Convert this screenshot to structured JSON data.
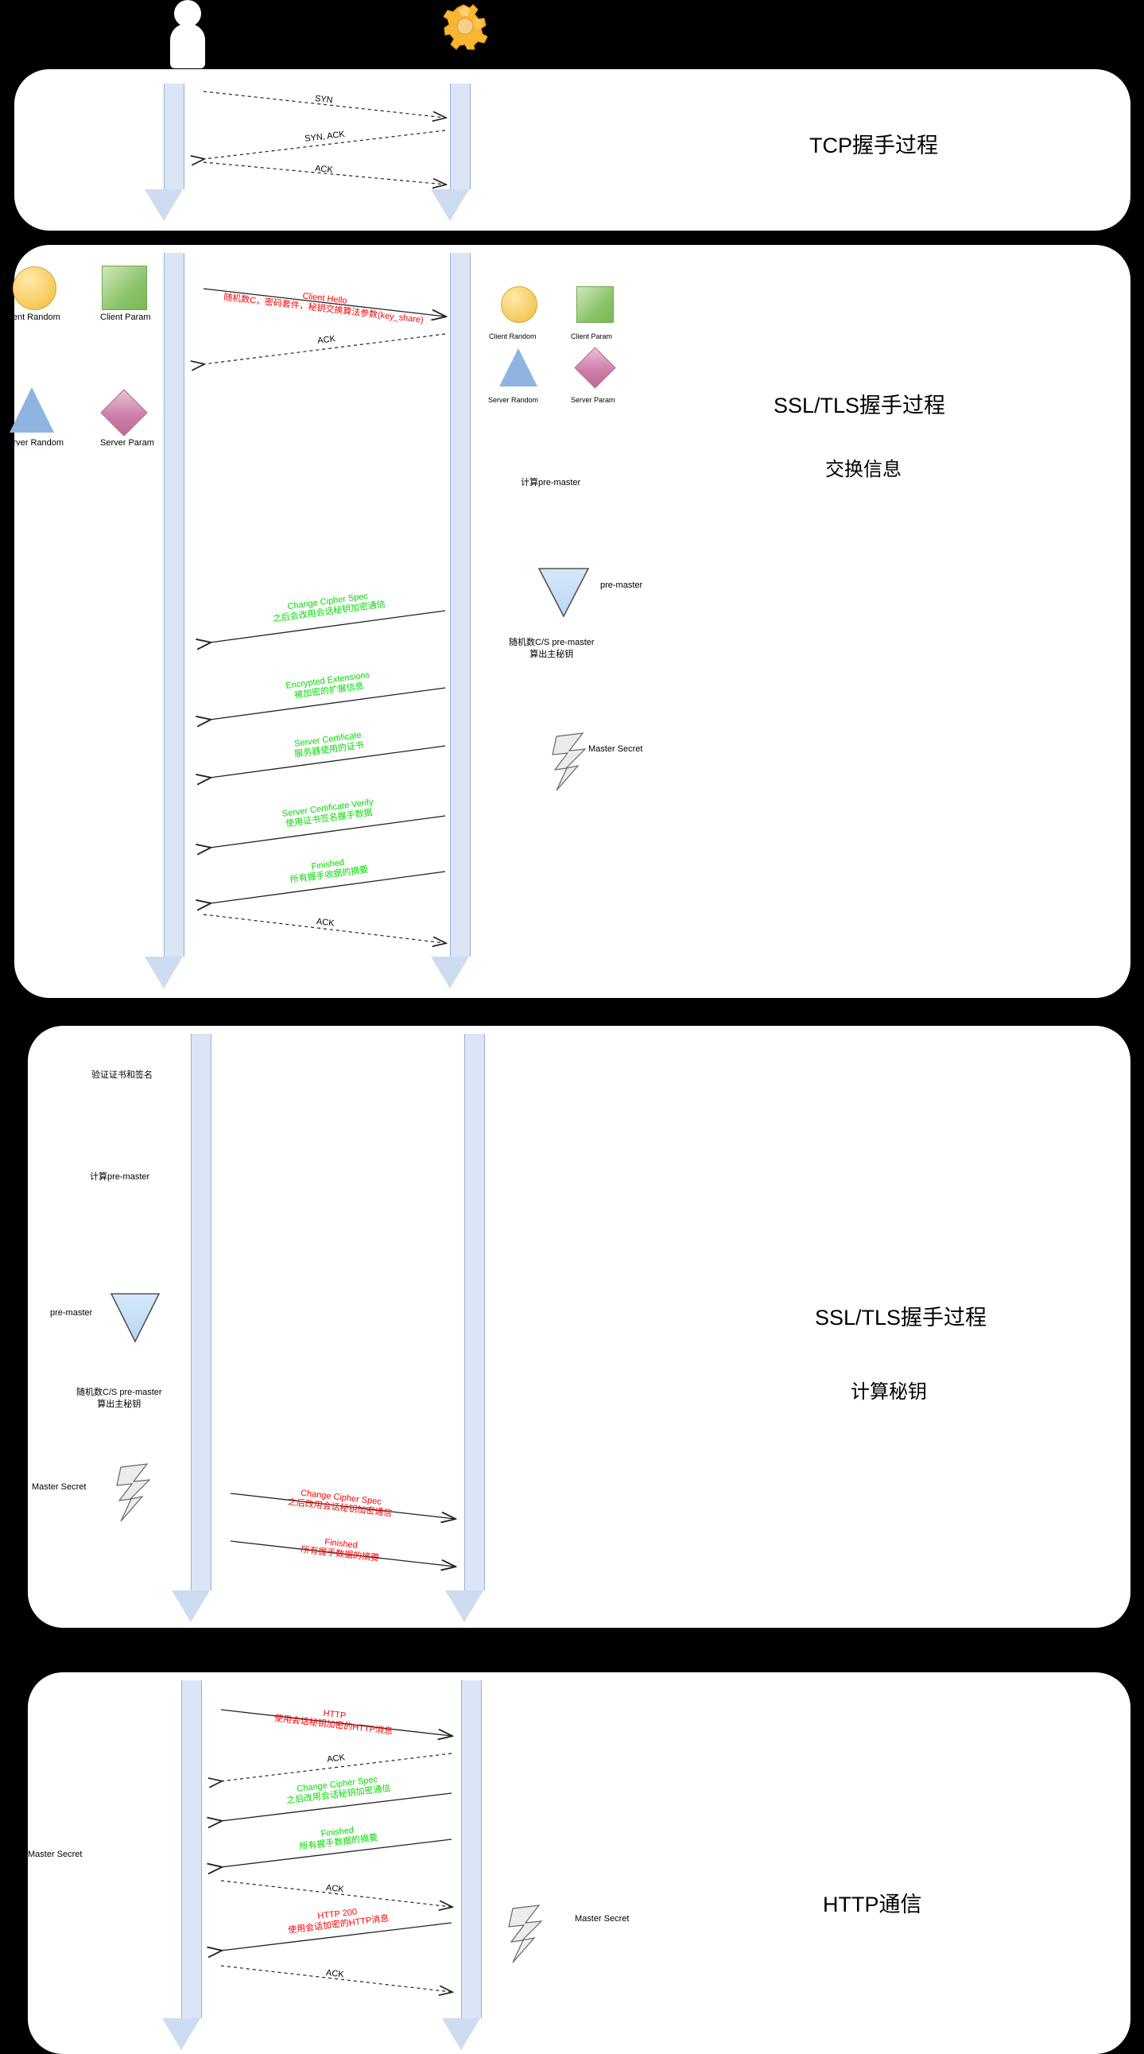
{
  "actors": {
    "client": "person-icon",
    "server": "gear-icon"
  },
  "panels": [
    {
      "id": "tcp",
      "title": "TCP握手过程",
      "subtitle": "",
      "messages": [
        {
          "label": "SYN",
          "sub": "",
          "dir": "right",
          "style": "dashed",
          "color": "#000000"
        },
        {
          "label": "SYN, ACK",
          "sub": "",
          "dir": "left",
          "style": "dashed",
          "color": "#000000"
        },
        {
          "label": "ACK",
          "sub": "",
          "dir": "right",
          "style": "dashed",
          "color": "#000000"
        }
      ]
    },
    {
      "id": "tls-exchange",
      "title": "SSL/TLS握手过程",
      "subtitle": "交换信息",
      "legend_left": [
        {
          "shape": "circle",
          "label": "Client Random",
          "color": "#f6c95b"
        },
        {
          "shape": "square",
          "label": "Client Param",
          "color": "#8cc46a"
        },
        {
          "shape": "triangle",
          "label": "Server Random",
          "color": "#8fb4e0"
        },
        {
          "shape": "diamond",
          "label": "Server Param",
          "color": "#cc7aa6"
        }
      ],
      "legend_right": [
        {
          "shape": "circle",
          "label": "Client Random",
          "color": "#f6c95b"
        },
        {
          "shape": "square",
          "label": "Client Param",
          "color": "#8cc46a"
        },
        {
          "shape": "triangle",
          "label": "Server Random",
          "color": "#8fb4e0"
        },
        {
          "shape": "diamond",
          "label": "Server Param",
          "color": "#cc7aa6"
        }
      ],
      "notes": [
        {
          "text": "计算pre-master"
        },
        {
          "text": "pre-master"
        },
        {
          "text": "随机数C/S pre-master\n算出主秘钥"
        },
        {
          "text": "Master Secret"
        }
      ],
      "messages": [
        {
          "label": "Client Hello",
          "sub": "随机数C，密码套件，秘钥交换算法参数(key_share)",
          "dir": "right",
          "style": "solid",
          "color": "#ff0000"
        },
        {
          "label": "ACK",
          "sub": "",
          "dir": "left",
          "style": "dashed",
          "color": "#000000"
        },
        {
          "label": "Change Cipher Spec",
          "sub": "之后会改用会话秘钥加密通信",
          "dir": "left",
          "style": "solid",
          "color": "#00dd00"
        },
        {
          "label": "Encrypted Extensions",
          "sub": "被加密的扩展信息",
          "dir": "left",
          "style": "solid",
          "color": "#00dd00"
        },
        {
          "label": "Server Certificate",
          "sub": "服务器使用的证书",
          "dir": "left",
          "style": "solid",
          "color": "#00dd00"
        },
        {
          "label": "Server Certificate Verify",
          "sub": "使用证书签名握手数据",
          "dir": "left",
          "style": "solid",
          "color": "#00dd00"
        },
        {
          "label": "Finished",
          "sub": "所有握手收据的摘要",
          "dir": "left",
          "style": "solid",
          "color": "#00dd00"
        },
        {
          "label": "ACK",
          "sub": "",
          "dir": "right",
          "style": "dashed",
          "color": "#000000"
        }
      ]
    },
    {
      "id": "tls-keys",
      "title": "SSL/TLS握手过程",
      "subtitle": "计算秘钥",
      "notes": [
        {
          "text": "验证证书和签名"
        },
        {
          "text": "计算pre-master"
        },
        {
          "text": "pre-master"
        },
        {
          "text": "随机数C/S pre-master\n算出主秘钥"
        },
        {
          "text": "Master Secret"
        }
      ],
      "messages": [
        {
          "label": "Change Cipher Spec",
          "sub": "之后改用会话秘钥加密通信",
          "dir": "right",
          "style": "solid",
          "color": "#ff0000"
        },
        {
          "label": "Finished",
          "sub": "所有握手数据的摘要",
          "dir": "right",
          "style": "solid",
          "color": "#ff0000"
        }
      ]
    },
    {
      "id": "http",
      "title": "HTTP通信",
      "subtitle": "",
      "notes": [
        {
          "text": "Master Secret"
        },
        {
          "text": "Master Secret"
        }
      ],
      "messages": [
        {
          "label": "HTTP",
          "sub": "使用会话秘钥加密的HTTP消息",
          "dir": "right",
          "style": "solid",
          "color": "#ff0000"
        },
        {
          "label": "ACK",
          "sub": "",
          "dir": "left",
          "style": "dashed",
          "color": "#000000"
        },
        {
          "label": "Change Cipher Spec",
          "sub": "之后改用会话秘钥加密通信",
          "dir": "left",
          "style": "solid",
          "color": "#00dd00"
        },
        {
          "label": "Finished",
          "sub": "所有握手数据的摘要",
          "dir": "left",
          "style": "solid",
          "color": "#00dd00"
        },
        {
          "label": "ACK",
          "sub": "",
          "dir": "right",
          "style": "dashed",
          "color": "#000000"
        },
        {
          "label": "HTTP 200",
          "sub": "使用会话加密的HTTP消息",
          "dir": "left",
          "style": "solid",
          "color": "#ff0000"
        },
        {
          "label": "ACK",
          "sub": "",
          "dir": "right",
          "style": "dashed",
          "color": "#000000"
        }
      ]
    }
  ],
  "colors": {
    "background": "#000000",
    "panel": "#ffffff",
    "lifeline": "#dbe5f5",
    "red": "#ff0000",
    "green": "#00dd00",
    "black": "#000000"
  }
}
